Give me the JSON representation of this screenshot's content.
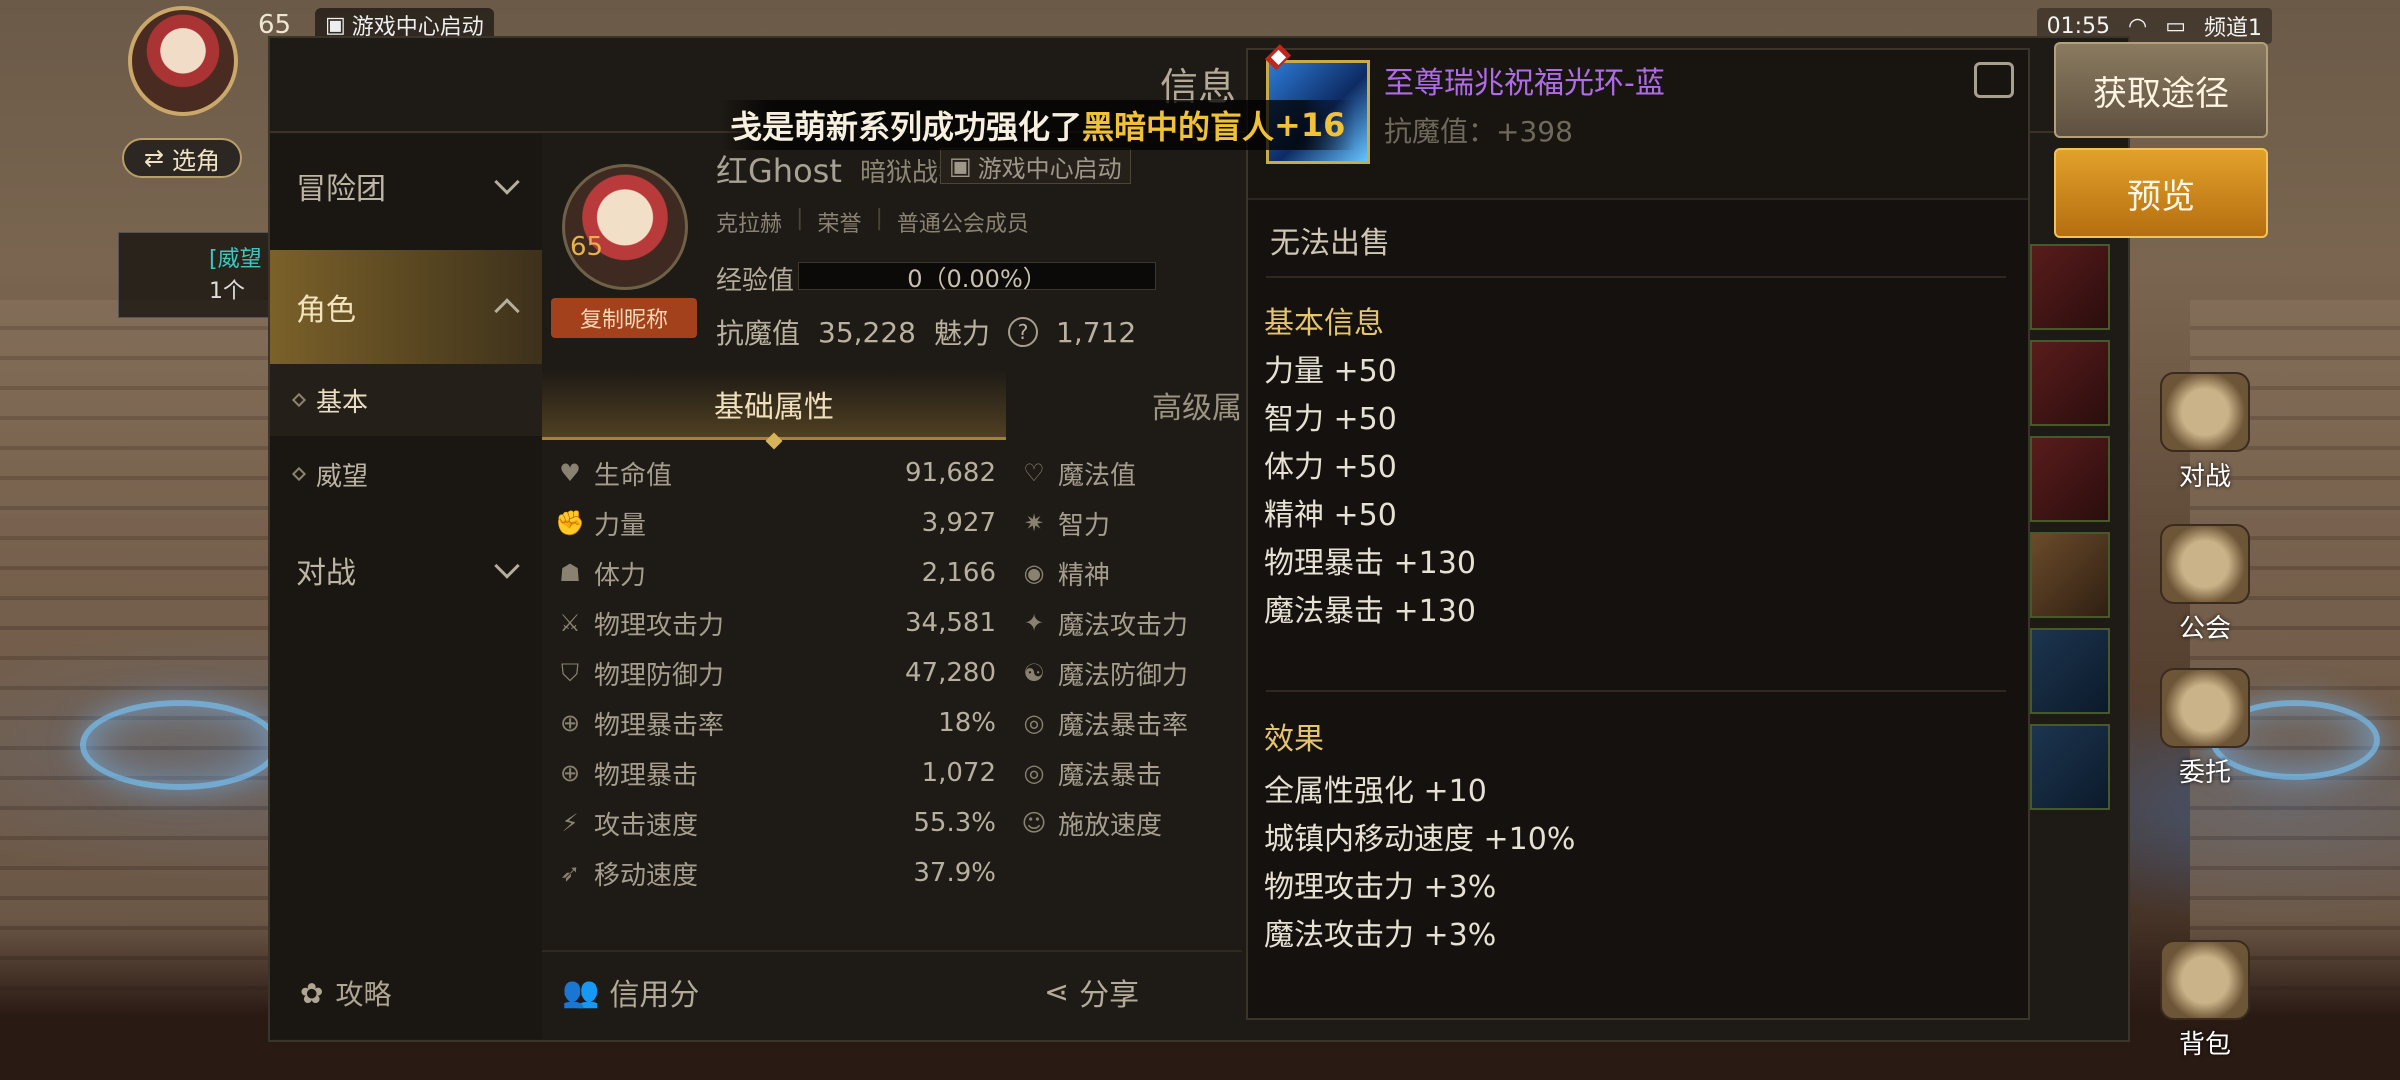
{
  "hud": {
    "level": "65",
    "launch_label": "游戏中心启动",
    "switch_label": "选角",
    "quest_line1": "[威望",
    "quest_line2": "1个"
  },
  "status": {
    "time": "01:55",
    "channel": "频道1"
  },
  "panel": {
    "title": "信息"
  },
  "nav": {
    "items": [
      {
        "label": "冒险团"
      },
      {
        "label": "角色"
      },
      {
        "label": "对战"
      }
    ],
    "subitems": [
      {
        "label": "基本"
      },
      {
        "label": "威望"
      }
    ],
    "guide_label": "攻略"
  },
  "character": {
    "level": "65",
    "copy_name_label": "复制昵称",
    "name": "红Ghost",
    "class": "暗狱战狂",
    "launch_tag": "游戏中心启动",
    "server": "克拉赫",
    "honor": "荣誉",
    "guild_role": "普通公会成员",
    "exp_label": "经验值",
    "exp_value": "0（0.00%）",
    "resist_label": "抗魔值",
    "resist_value": "35,228",
    "charm_label": "魅力",
    "charm_value": "1,712"
  },
  "tabs": {
    "basic": "基础属性",
    "advanced": "高级属"
  },
  "stats": [
    {
      "left_label": "生命值",
      "left_value": "91,682",
      "right_label": "魔法值"
    },
    {
      "left_label": "力量",
      "left_value": "3,927",
      "right_label": "智力"
    },
    {
      "left_label": "体力",
      "left_value": "2,166",
      "right_label": "精神"
    },
    {
      "left_label": "物理攻击力",
      "left_value": "34,581",
      "right_label": "魔法攻击力"
    },
    {
      "left_label": "物理防御力",
      "left_value": "47,280",
      "right_label": "魔法防御力"
    },
    {
      "left_label": "物理暴击率",
      "left_value": "18%",
      "right_label": "魔法暴击率"
    },
    {
      "left_label": "物理暴击",
      "left_value": "1,072",
      "right_label": "魔法暴击"
    },
    {
      "left_label": "攻击速度",
      "left_value": "55.3%",
      "right_label": "施放速度"
    },
    {
      "left_label": "移动速度",
      "left_value": "37.9%",
      "right_label": ""
    }
  ],
  "bottom": {
    "credit_label": "信用分",
    "share_label": "分享"
  },
  "broadcast": {
    "prefix": "戋是萌新系列成功强化了",
    "item": "黑暗中的盲人",
    "suffix": " +16"
  },
  "item": {
    "name": "至尊瑞兆祝福光环-蓝",
    "resist": "抗魔值：+398",
    "no_sell": "无法出售",
    "basic_title": "基本信息",
    "basic_attrs": [
      "力量 +50",
      "智力 +50",
      "体力 +50",
      "精神 +50",
      "物理暴击 +130",
      "魔法暴击 +130"
    ],
    "effect_title": "效果",
    "effects": [
      "全属性强化 +10",
      "城镇内移动速度 +10%",
      "物理攻击力 +3%",
      "魔法攻击力 +3%"
    ]
  },
  "actions": {
    "obtain_label": "获取途径",
    "preview_label": "预览"
  },
  "side_icons": [
    {
      "label": "对战"
    },
    {
      "label": "公会"
    },
    {
      "label": "委托"
    },
    {
      "label": "背包"
    }
  ],
  "colors": {
    "accent_gold": "#d7b35a",
    "item_purple": "#b06ce8",
    "section_gold": "#e4c56e",
    "preview_orange": "#e2a12a"
  }
}
